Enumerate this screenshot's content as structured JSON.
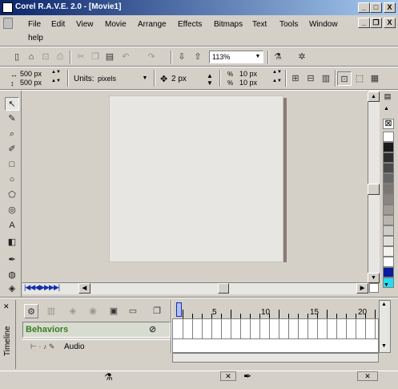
{
  "window": {
    "title": "Corel R.A.V.E. 2.0 - [Movie1]"
  },
  "titlebar_buttons": {
    "min": "_",
    "max": "□",
    "close": "X"
  },
  "doc_buttons": {
    "min": "_",
    "restore": "❐",
    "close": "X"
  },
  "menu": [
    "File",
    "Edit",
    "View",
    "Movie",
    "Arrange",
    "Effects",
    "Bitmaps",
    "Text",
    "Tools",
    "Window",
    "help"
  ],
  "toolbar": {
    "zoom": "113%"
  },
  "propbar": {
    "width": "500 px",
    "height": "500 px",
    "units_label": "Units:",
    "units_value": "pixels",
    "nudge": "2 px",
    "dup_x": "10 px",
    "dup_y": "10 px"
  },
  "timeline": {
    "label": "Timeline",
    "behaviors": "Behaviors",
    "layer": "Audio",
    "frames": [
      "5",
      "10",
      "15",
      "20"
    ]
  },
  "palette": [
    "#ffffff",
    "#1a1a1a",
    "#2e2e2e",
    "#4a4a4a",
    "#676767",
    "#7b7874",
    "#8a8580",
    "#a09c96",
    "#b8b4ae",
    "#cfcbc5",
    "#e2dfda",
    "#f4f2ef",
    "#ffffff",
    "#0a1d9c",
    "#22ddee"
  ],
  "icons": {
    "app": "rave-app-icon"
  }
}
